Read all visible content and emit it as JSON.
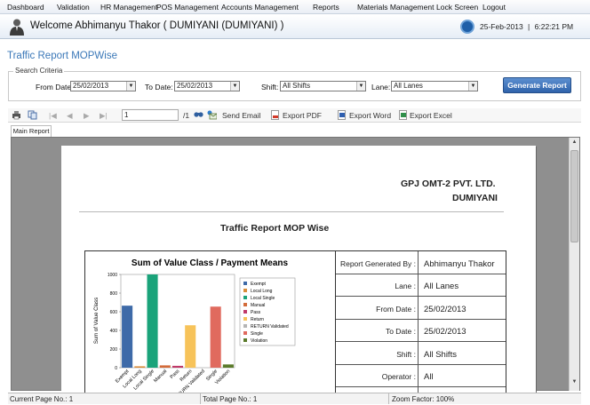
{
  "menu": [
    "Dashboard",
    "Validation",
    "HR Management",
    "POS Management",
    "Accounts Management",
    "Reports",
    "Materials Management",
    "Lock Screen",
    "Logout"
  ],
  "welcome": "Welcome Abhimanyu Thakor ( DUMIYANI (DUMIYANI) )",
  "datetime": {
    "date": "25-Feb-2013",
    "sep": "|",
    "time": "6:22:21 PM"
  },
  "page_title": "Traffic Report MOPWise",
  "criteria": {
    "legend": "Search Criteria",
    "from_label": "From Date:",
    "from_value": "25/02/2013",
    "to_label": "To Date:",
    "to_value": "25/02/2013",
    "shift_label": "Shift:",
    "shift_value": "All Shifts",
    "lane_label": "Lane:",
    "lane_value": "All Lanes",
    "generate": "Generate Report"
  },
  "toolbar": {
    "page": "1",
    "of": "/1",
    "send_email": "Send Email",
    "export_pdf": "Export PDF",
    "export_word": "Export Word",
    "export_excel": "Export Excel"
  },
  "tab": "Main Report",
  "report": {
    "company": "GPJ OMT-2 PVT. LTD.",
    "plaza": "DUMIYANI",
    "title": "Traffic Report MOP Wise",
    "info": [
      {
        "label": "Report Generated By :",
        "value": "Abhimanyu Thakor"
      },
      {
        "label": "Lane :",
        "value": "All Lanes"
      },
      {
        "label": "From Date :",
        "value": "25/02/2013"
      },
      {
        "label": "To Date :",
        "value": "25/02/2013"
      },
      {
        "label": "Shift :",
        "value": "All Shifts"
      },
      {
        "label": "Operator :",
        "value": "All"
      }
    ]
  },
  "chart_data": {
    "type": "bar",
    "title": "Sum of Value Class / Payment Means",
    "ylabel": "Sum of Value Class",
    "xlabel": "",
    "ylim": [
      0,
      1000
    ],
    "yticks": [
      0,
      200,
      400,
      600,
      800,
      1000
    ],
    "categories": [
      "Exempt",
      "Local Long",
      "Local Single",
      "Manual",
      "Pass",
      "Return",
      "RETURN Validated",
      "Single",
      "Violation"
    ],
    "values": [
      665,
      15,
      1000,
      25,
      20,
      455,
      0,
      655,
      35
    ],
    "colors": [
      "#3e6aa8",
      "#d98c3a",
      "#1aa37a",
      "#d36b3a",
      "#c03a6a",
      "#f7c35a",
      "#b5b5b5",
      "#e06a5e",
      "#5a7a2a"
    ],
    "legend": [
      "Exempt",
      "Local Long",
      "Local Single",
      "Manual",
      "Pass",
      "Return",
      "RETURN Validated",
      "Single",
      "Violation"
    ],
    "legend_position": "right"
  },
  "status": {
    "current_page": "Current Page No.: 1",
    "total_page": "Total Page No.: 1",
    "zoom": "Zoom Factor: 100%"
  }
}
